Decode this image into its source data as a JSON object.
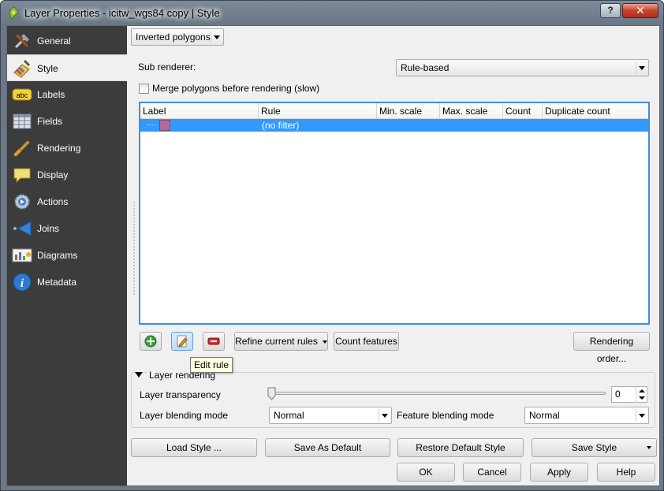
{
  "window": {
    "title": "Layer Properties - icitw_wgs84 copy | Style",
    "help_button": "?",
    "close_button": "✕"
  },
  "sidebar": {
    "items": [
      {
        "label": "General",
        "icon": "general-icon"
      },
      {
        "label": "Style",
        "icon": "style-icon"
      },
      {
        "label": "Labels",
        "icon": "labels-icon"
      },
      {
        "label": "Fields",
        "icon": "fields-icon"
      },
      {
        "label": "Rendering",
        "icon": "rendering-icon"
      },
      {
        "label": "Display",
        "icon": "display-icon"
      },
      {
        "label": "Actions",
        "icon": "actions-icon"
      },
      {
        "label": "Joins",
        "icon": "joins-icon"
      },
      {
        "label": "Diagrams",
        "icon": "diagrams-icon"
      },
      {
        "label": "Metadata",
        "icon": "metadata-icon"
      }
    ],
    "active_index": 1
  },
  "style": {
    "renderer_type": "Inverted polygons",
    "sub_renderer_label": "Sub renderer:",
    "sub_renderer_value": "Rule-based",
    "merge_label": "Merge polygons before rendering (slow)",
    "merge_checked": false
  },
  "rules_table": {
    "columns": [
      "Label",
      "Rule",
      "Min. scale",
      "Max. scale",
      "Count",
      "Duplicate count"
    ],
    "rows": [
      {
        "label": "",
        "rule": "(no filter)",
        "swatch_color": "#b06b9b"
      }
    ]
  },
  "rule_toolbar": {
    "add_icon": "add-rule-icon",
    "edit_icon": "edit-rule-icon",
    "remove_icon": "remove-rule-icon",
    "refine_label": "Refine current rules",
    "count_label": "Count features",
    "rendering_order_label": "Rendering order...",
    "tooltip": "Edit rule"
  },
  "layer_rendering": {
    "group_title": "Layer rendering",
    "transparency_label": "Layer transparency",
    "transparency_value": "0",
    "blending_label": "Layer blending mode",
    "blending_value": "Normal",
    "feature_blending_label": "Feature blending mode",
    "feature_blending_value": "Normal"
  },
  "style_buttons": {
    "load": "Load Style ...",
    "save_default": "Save As Default",
    "restore_default": "Restore Default Style",
    "save": "Save Style"
  },
  "dialog_buttons": {
    "ok": "OK",
    "cancel": "Cancel",
    "apply": "Apply",
    "help": "Help"
  },
  "colors": {
    "sidebar_bg": "#3c3c3c",
    "selection": "#3399ff",
    "focus_border": "#3d8fe0"
  }
}
